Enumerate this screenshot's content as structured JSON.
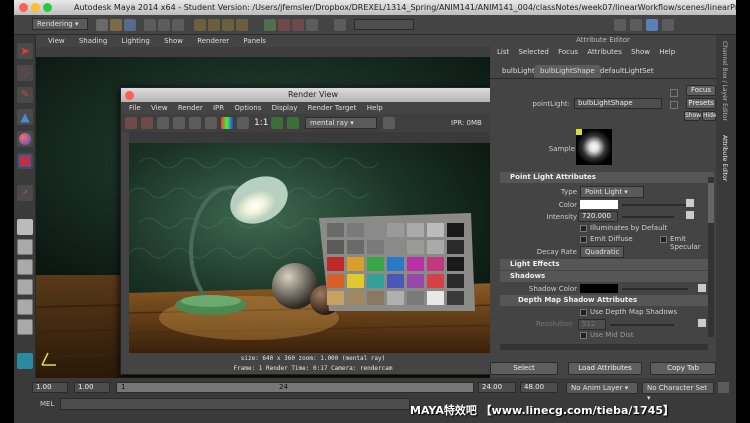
{
  "window": {
    "title": "Autodesk Maya 2014 x64 - Student Version: /Users/jfemsler/Dropbox/DREXEL/1314_Spring/ANIM141/ANIM141_004/classNotes/week07/linearWorkflow/scenes/linearPreSetu..."
  },
  "shelf": {
    "menu_set": "Rendering"
  },
  "viewport": {
    "menu": [
      "View",
      "Shading",
      "Lighting",
      "Show",
      "Renderer",
      "Panels"
    ]
  },
  "render_view": {
    "title": "Render View",
    "menu": [
      "File",
      "View",
      "Render",
      "IPR",
      "Options",
      "Display",
      "Render Target",
      "Help"
    ],
    "zoom_label": "1:1",
    "renderer": "mental ray",
    "ipr_label": "IPR: 0MB",
    "status_line1": "size: 640 x 360  zoom: 1.000       (mental ray)",
    "status_line2": "Frame: 1     Render Time: 0:17     Camera: rendercam"
  },
  "attribute_editor": {
    "title": "Attribute Editor",
    "menu": [
      "List",
      "Selected",
      "Focus",
      "Attributes",
      "Show",
      "Help"
    ],
    "tabs": [
      "bulbLight",
      "bulbLightShape",
      "defaultLightSet"
    ],
    "node_label": "pointLight:",
    "node_name": "bulbLightShape",
    "focus": "Focus",
    "presets": "Presets",
    "show": "Show",
    "hide": "Hide",
    "sample": "Sample",
    "section_point_light": "Point Light Attributes",
    "type_label": "Type",
    "type_value": "Point Light",
    "color_label": "Color",
    "intensity_label": "Intensity",
    "intensity_value": "720.000",
    "illum_default": "Illuminates by Default",
    "emit_diffuse": "Emit Diffuse",
    "emit_specular": "Emit Specular",
    "decay_label": "Decay Rate",
    "decay_value": "Quadratic",
    "light_effects": "Light Effects",
    "shadows": "Shadows",
    "shadow_color": "Shadow Color",
    "depth_map": "Depth Map Shadow Attributes",
    "use_depth": "Use Depth Map Shadows",
    "resolution": "Resolution",
    "resolution_value": "512",
    "use_mid": "Use Mid Dist",
    "select": "Select",
    "load_attrs": "Load Attributes",
    "copy_tab": "Copy Tab"
  },
  "right_tabs": [
    "Channel Box / Layer Editor",
    "Attribute Editor"
  ],
  "timeline": {
    "start": "1.00",
    "current": "1.00",
    "frame": "1",
    "end_tick": "24",
    "range_end": "24.00",
    "anim_end": "48.00",
    "anim_layer": "No Anim Layer",
    "char_set": "No Character Set",
    "mel": "MEL"
  },
  "watermark": "MAYA特效吧  【www.linecg.com/tieba/1745】",
  "colors": {
    "accent": "#5a7fb4",
    "panel": "#444444",
    "frame": "#3c3c3c"
  }
}
